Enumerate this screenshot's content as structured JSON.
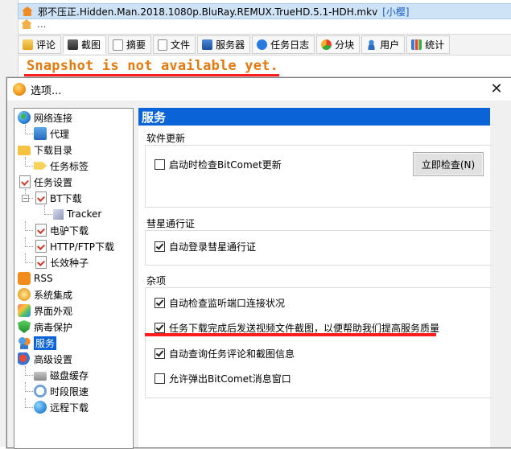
{
  "background": {
    "rows": [
      {
        "name": "邪不压正.Hidden.Man.2018.1080p.BluRay.REMUX.TrueHD.5.1-HDH.mkv",
        "tag": "[小樱]"
      },
      {
        "name": "...",
        "tag": ""
      }
    ],
    "tabs": [
      {
        "label": "评论",
        "icon": "comment-icon"
      },
      {
        "label": "截图",
        "icon": "screenshot-icon"
      },
      {
        "label": "摘要",
        "icon": "summary-icon"
      },
      {
        "label": "文件",
        "icon": "file-icon"
      },
      {
        "label": "服务器",
        "icon": "server-icon"
      },
      {
        "label": "任务日志",
        "icon": "log-icon"
      },
      {
        "label": "分块",
        "icon": "pie-icon"
      },
      {
        "label": "用户",
        "icon": "user-icon"
      },
      {
        "label": "统计",
        "icon": "stats-icon"
      }
    ],
    "snapshot_message": "Snapshot is not available yet."
  },
  "dialog": {
    "title": "选项...",
    "close_label": "✕",
    "tree": [
      {
        "label": "网络连接",
        "icon": "globe-icon",
        "level": 0
      },
      {
        "label": "代理",
        "icon": "proxy-icon",
        "level": 1
      },
      {
        "label": "下载目录",
        "icon": "folder-icon",
        "level": 0
      },
      {
        "label": "任务标签",
        "icon": "tag-icon",
        "level": 1
      },
      {
        "label": "任务设置",
        "icon": "task-icon",
        "level": 0
      },
      {
        "label": "BT下载",
        "icon": "task-icon",
        "level": 1
      },
      {
        "label": "Tracker",
        "icon": "cube-icon",
        "level": 2
      },
      {
        "label": "电驴下载",
        "icon": "task-icon",
        "level": 1
      },
      {
        "label": "HTTP/FTP下载",
        "icon": "task-icon",
        "level": 1
      },
      {
        "label": "长效种子",
        "icon": "task-icon",
        "level": 1
      },
      {
        "label": "RSS",
        "icon": "rss-icon",
        "level": 0
      },
      {
        "label": "系统集成",
        "icon": "gear-icon",
        "level": 0
      },
      {
        "label": "界面外观",
        "icon": "brush-icon",
        "level": 0
      },
      {
        "label": "病毒保护",
        "icon": "shield-icon",
        "level": 0
      },
      {
        "label": "服务",
        "icon": "users-icon",
        "level": 0,
        "selected": true
      },
      {
        "label": "高级设置",
        "icon": "advanced-icon",
        "level": 0
      },
      {
        "label": "磁盘缓存",
        "icon": "disk-icon",
        "level": 1
      },
      {
        "label": "时段限速",
        "icon": "clock-icon",
        "level": 1
      },
      {
        "label": "远程下载",
        "icon": "remote-icon",
        "level": 1
      }
    ],
    "panel_title": "服务",
    "sections": {
      "update": {
        "title": "软件更新",
        "check_on_start": {
          "label": "启动时检查BitComet更新",
          "checked": false
        },
        "check_now_button": "立即检查(N)"
      },
      "passport": {
        "title": "彗星通行证",
        "auto_login": {
          "label": "自动登录彗星通行证",
          "checked": true
        }
      },
      "misc": {
        "title": "杂项",
        "items": [
          {
            "label": "自动检查监听端口连接状况",
            "checked": true
          },
          {
            "label": "任务下载完成后发送视频文件截图，以便帮助我们提高服务质量",
            "checked": true
          },
          {
            "label": "自动查询任务评论和截图信息",
            "checked": true
          },
          {
            "label": "允许弹出BitComet消息窗口",
            "checked": false
          }
        ]
      }
    }
  },
  "colors": {
    "accent": "#0a64d8",
    "highlight_line": "#ff1c1c",
    "snapshot_text": "#e27a10"
  }
}
